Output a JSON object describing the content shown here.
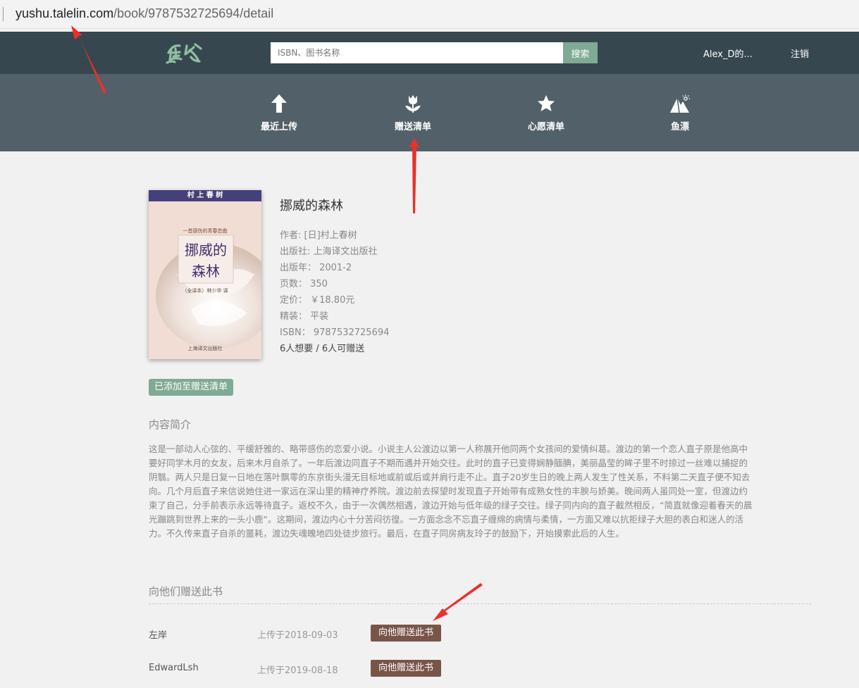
{
  "browser": {
    "url_host": "yushu.talelin.com",
    "url_path": "/book/9787532725694/detail"
  },
  "header": {
    "logo_text": "鱼书",
    "search_placeholder": "ISBN、图书名称",
    "search_button": "搜索",
    "user_name": "Alex_D的...",
    "logout": "注销"
  },
  "nav": [
    {
      "label": "最近上传",
      "icon": "arrow-up-icon"
    },
    {
      "label": "赠送清单",
      "icon": "tulip-icon"
    },
    {
      "label": "心愿清单",
      "icon": "star-icon"
    },
    {
      "label": "鱼漂",
      "icon": "mountain-icon"
    }
  ],
  "book": {
    "title": "挪威的森林",
    "author": "作者: [日]村上春树",
    "publisher": "出版社: 上海译文出版社",
    "pubdate": "出版年：  2001-2",
    "pages": "页数：  350",
    "price": "定价：  ￥18.80元",
    "binding": "精装：  平装",
    "isbn": "ISBN：  9787532725694",
    "stats": "6人想要 / 6人可赠送",
    "cover": {
      "author_band": "村 上 春 树",
      "title_line1": "挪威的",
      "title_line2": "森林",
      "subtitle": "一首感伤的青春恋曲",
      "translator": "（全译本）林少华 译",
      "publisher": "上海译文出版社"
    }
  },
  "added_badge": "已添加至赠送清单",
  "summary_title": "内容简介",
  "summary": "这是一部动人心弦的、平缓舒雅的、略带感伤的恋爱小说。小说主人公渡边以第一人称展开他同两个女孩间的爱情纠葛。渡边的第一个恋人直子原是他高中要好同学木月的女友，后来木月自杀了。一年后渡边同直子不期而遇并开始交往。此时的直子已变得娴静腼腆，美丽晶莹的眸子里不时掠过一丝难以捕捉的阴翳。两人只是日复一日地在落叶飘零的东京街头漫无目标地或前或后或并肩行走不止。直子20岁生日的晚上两人发生了性关系，不料第二天直子便不知去向。几个月后直子来信说她住进一家远在深山里的精神疗养院。渡边前去探望时发现直子开始带有成熟女性的丰腴与娇美。晚间两人虽同处一室，但渡边约束了自己，分手前表示永远等待直子。返校不久，由于一次偶然相遇，渡边开始与低年级的绿子交往。绿子同内向的直子截然相反，“简直就像迎着春天的晨光蹦跳到世界上来的一头小鹿”。这期间，渡边内心十分苦闷彷徨。一方面念念不忘直子缠绵的病情与柔情，一方面又难以抗拒绿子大胆的表白和迷人的活力。不久传来直子自杀的噩耗，渡边失魂魄地四处徒步旅行。最后，在直子同房病友玲子的鼓励下，开始摸索此后的人生。",
  "donors_title": "向他们赠送此书",
  "donors": [
    {
      "name": "左岸",
      "date": "上传于2018-09-03",
      "button": "向他赠送此书"
    },
    {
      "name": "EdwardLsh",
      "date": "上传于2019-08-18",
      "button": "向他赠送此书"
    }
  ],
  "colors": {
    "topbar": "#37474f",
    "navbar": "#526069",
    "accent_green": "#7faa93",
    "gift_button": "#795548",
    "annotation_arrow": "#e8322b"
  }
}
